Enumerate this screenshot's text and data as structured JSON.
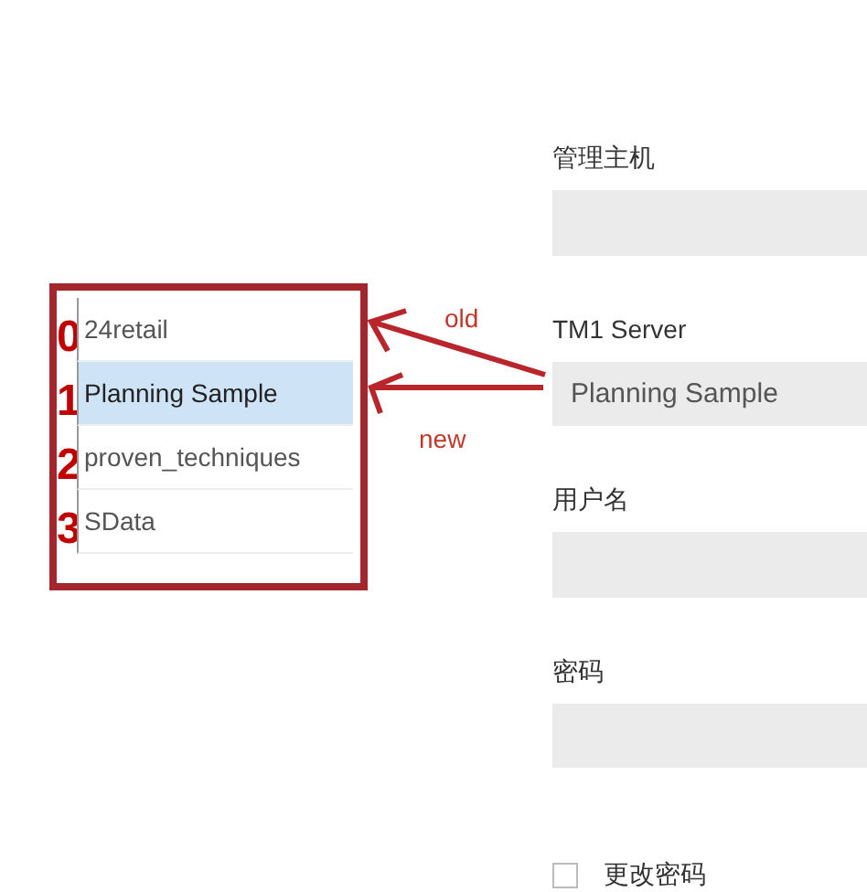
{
  "server_list": {
    "items": [
      {
        "marker": "0",
        "label": "24retail",
        "selected": false
      },
      {
        "marker": "1",
        "label": "Planning Sample",
        "selected": true
      },
      {
        "marker": "2",
        "label": "proven_techniques",
        "selected": false
      },
      {
        "marker": "3",
        "label": "SData",
        "selected": false
      }
    ]
  },
  "annotations": [
    {
      "label": "old"
    },
    {
      "label": "new"
    }
  ],
  "form": {
    "fields": [
      {
        "label": "管理主机"
      },
      {
        "label": "TM1 Server",
        "value": "Planning Sample"
      },
      {
        "label": "用户名"
      },
      {
        "label": "密码"
      }
    ],
    "checkbox": {
      "label": "更改密码",
      "checked": false
    }
  }
}
